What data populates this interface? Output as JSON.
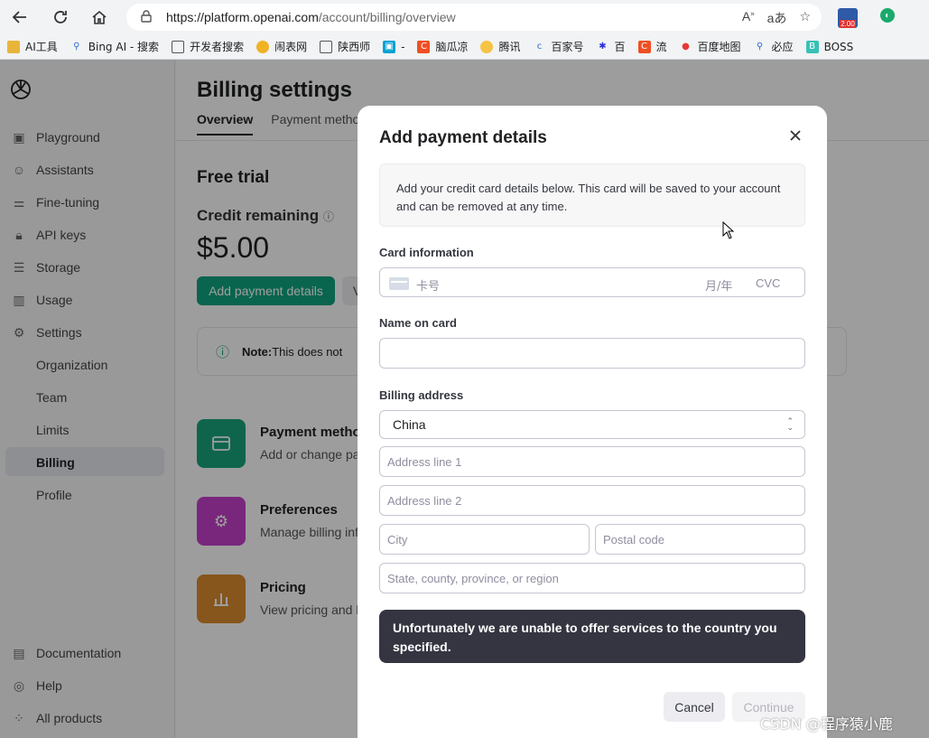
{
  "browser": {
    "url_host": "https://platform.openai.com",
    "url_path": "/account/billing/overview",
    "ext_badge": "2.00",
    "bookmarks": [
      "AI工具",
      "Bing AI - 搜索",
      "开发者搜索",
      "闹表网",
      "陕西师",
      "-",
      "脑瓜凉",
      "腾讯",
      "百家号",
      "百",
      "流",
      "百度地图",
      "必应",
      "BOSS"
    ]
  },
  "sidebar": {
    "items": [
      {
        "label": "Playground",
        "icon": "playground-icon"
      },
      {
        "label": "Assistants",
        "icon": "assistants-icon"
      },
      {
        "label": "Fine-tuning",
        "icon": "fine-tuning-icon"
      },
      {
        "label": "API keys",
        "icon": "lock-icon"
      },
      {
        "label": "Storage",
        "icon": "database-icon"
      },
      {
        "label": "Usage",
        "icon": "bar-chart-icon"
      },
      {
        "label": "Settings",
        "icon": "gear-icon"
      }
    ],
    "sub_items": [
      "Organization",
      "Team",
      "Limits",
      "Billing",
      "Profile"
    ],
    "active": "Billing",
    "bottom": [
      {
        "label": "Documentation",
        "icon": "document-icon"
      },
      {
        "label": "Help",
        "icon": "help-icon"
      },
      {
        "label": "All products",
        "icon": "grid-icon"
      }
    ]
  },
  "main": {
    "title": "Billing settings",
    "tabs": [
      "Overview",
      "Payment metho"
    ],
    "free_trial": "Free trial",
    "credit_label": "Credit remaining",
    "credit_value": "$5.00",
    "add_payment_label": "Add payment details",
    "view_label": "V",
    "note_bold": "Note:",
    "note_text": " This does not",
    "cards": [
      {
        "title": "Payment metho",
        "sub": "Add or change pa",
        "color": "#19a37b",
        "icon": "credit-card-icon"
      },
      {
        "title": "Preferences",
        "sub": "Manage billing inf",
        "color": "#c340c8",
        "icon": "gear-icon"
      },
      {
        "title": "Pricing",
        "sub": "View pricing and l",
        "color": "#d98b30",
        "icon": "bar-chart-icon"
      }
    ]
  },
  "modal": {
    "title": "Add payment details",
    "info": "Add your credit card details below. This card will be saved to your account and can be removed at any time.",
    "card_info_label": "Card information",
    "card_number_placeholder": "卡号",
    "expiry_placeholder": "月/年",
    "cvc_placeholder": "CVC",
    "name_label": "Name on card",
    "name_value": "",
    "billing_label": "Billing address",
    "country": "China",
    "address1_placeholder": "Address line 1",
    "address2_placeholder": "Address line 2",
    "city_placeholder": "City",
    "postal_placeholder": "Postal code",
    "state_placeholder": "State, county, province, or region",
    "error": "Unfortunately we are unable to offer services to the country you specified.",
    "cancel_label": "Cancel",
    "continue_label": "Continue"
  },
  "watermark": "CSDN @程序猿小鹿"
}
